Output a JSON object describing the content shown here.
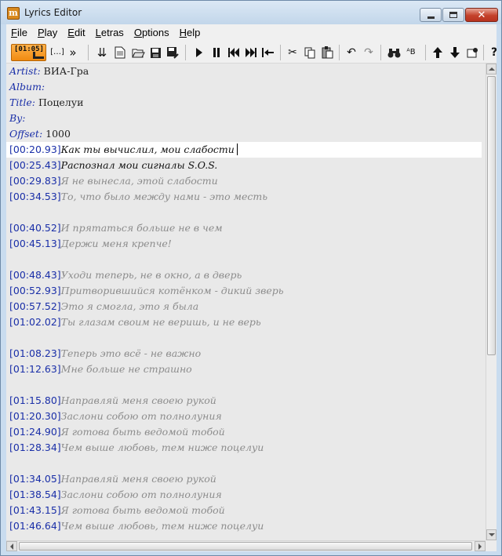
{
  "window": {
    "title": "Lyrics Editor",
    "icon_letter": "m"
  },
  "menu": [
    {
      "key": "F",
      "rest": "ile"
    },
    {
      "key": "P",
      "rest": "lay"
    },
    {
      "key": "E",
      "rest": "dit"
    },
    {
      "key": "L",
      "rest": "etras"
    },
    {
      "key": "O",
      "rest": "ptions"
    },
    {
      "key": "H",
      "rest": "elp"
    }
  ],
  "toolbar": {
    "time": "[01:05]"
  },
  "meta": [
    {
      "tag": "Artist:",
      "value": " ВИА-Гра"
    },
    {
      "tag": "Album:",
      "value": ""
    },
    {
      "tag": "Title:",
      "value": " Поцелуи"
    },
    {
      "tag": "By:",
      "value": ""
    },
    {
      "tag": "Offset:",
      "value": " 1000"
    }
  ],
  "lyrics": [
    {
      "ts": "[00:20.93]",
      "text": "Как ты вычислил, мои слабости",
      "state": "current"
    },
    {
      "ts": "[00:25.43]",
      "text": "Распознал мои сигналы S.O.S.",
      "state": "sung"
    },
    {
      "ts": "[00:29.83]",
      "text": "Я не вынесла, этой слабости",
      "state": "pending"
    },
    {
      "ts": "[00:34.53]",
      "text": "То, что было между нами - это месть",
      "state": "pending"
    },
    {
      "ts": "",
      "text": "",
      "state": "blank"
    },
    {
      "ts": "[00:40.52]",
      "text": "И прятаться больше не в чем",
      "state": "pending"
    },
    {
      "ts": "[00:45.13]",
      "text": "Держи меня крепче!",
      "state": "pending"
    },
    {
      "ts": "",
      "text": "",
      "state": "blank"
    },
    {
      "ts": "[00:48.43]",
      "text": "Уходи теперь, не в окно, а в дверь",
      "state": "pending"
    },
    {
      "ts": "[00:52.93]",
      "text": "Притворившийся котёнком - дикий зверь",
      "state": "pending"
    },
    {
      "ts": "[00:57.52]",
      "text": "Это я смогла, это я была",
      "state": "pending"
    },
    {
      "ts": "[01:02.02]",
      "text": "Ты глазам своим не веришь, и не верь",
      "state": "pending"
    },
    {
      "ts": "",
      "text": "",
      "state": "blank"
    },
    {
      "ts": "[01:08.23]",
      "text": "Теперь это всё - не важно",
      "state": "pending"
    },
    {
      "ts": "[01:12.63]",
      "text": "Мне больше не страшно",
      "state": "pending"
    },
    {
      "ts": "",
      "text": "",
      "state": "blank"
    },
    {
      "ts": "[01:15.80]",
      "text": "Направляй меня своею рукой",
      "state": "pending"
    },
    {
      "ts": "[01:20.30]",
      "text": "Заслони собою от полнолуния",
      "state": "pending"
    },
    {
      "ts": "[01:24.90]",
      "text": "Я готова быть ведомой тобой",
      "state": "pending"
    },
    {
      "ts": "[01:28.34]",
      "text": "Чем выше любовь, тем ниже поцелуи",
      "state": "pending"
    },
    {
      "ts": "",
      "text": "",
      "state": "blank"
    },
    {
      "ts": "[01:34.05]",
      "text": "Направляй меня своею рукой",
      "state": "pending"
    },
    {
      "ts": "[01:38.54]",
      "text": "Заслони собою от полнолуния",
      "state": "pending"
    },
    {
      "ts": "[01:43.15]",
      "text": "Я готова быть ведомой тобой",
      "state": "pending"
    },
    {
      "ts": "[01:46.64]",
      "text": "Чем выше любовь, тем ниже поцелуи",
      "state": "pending"
    }
  ],
  "colors": {
    "tag": "#1a2fa8",
    "sung": "#111111",
    "pending": "#8c8c8c",
    "editor_bg": "#e9e9e9",
    "accent": "#f08a10"
  }
}
